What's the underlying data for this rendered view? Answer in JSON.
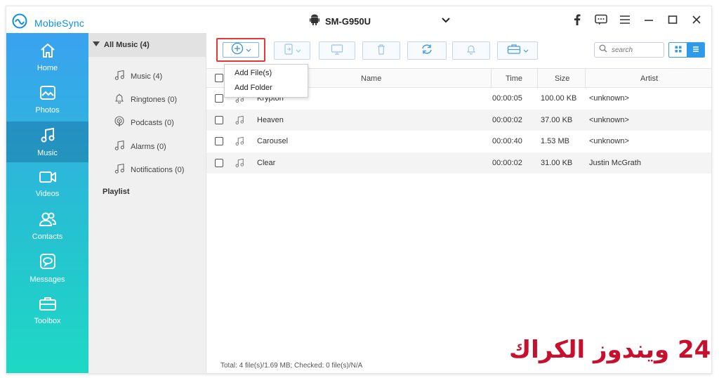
{
  "app": {
    "name": "MobieSync",
    "brand_color": "#0d8fe0"
  },
  "device": {
    "name": "SM-G950U"
  },
  "window_controls": [
    "facebook-icon",
    "feedback-icon",
    "menu-icon",
    "minimize-icon",
    "maximize-icon",
    "close-icon"
  ],
  "sidebar": {
    "items": [
      {
        "label": "Home",
        "icon": "home-icon",
        "active": false
      },
      {
        "label": "Photos",
        "icon": "photos-icon",
        "active": false
      },
      {
        "label": "Music",
        "icon": "music-icon",
        "active": true
      },
      {
        "label": "Videos",
        "icon": "videos-icon",
        "active": false
      },
      {
        "label": "Contacts",
        "icon": "contacts-icon",
        "active": false
      },
      {
        "label": "Messages",
        "icon": "messages-icon",
        "active": false
      },
      {
        "label": "Toolbox",
        "icon": "toolbox-icon",
        "active": false
      }
    ]
  },
  "categories": {
    "header": "All Music (4)",
    "items": [
      {
        "label": "Music (4)",
        "icon": "music-note-icon"
      },
      {
        "label": "Ringtones (0)",
        "icon": "bell-icon"
      },
      {
        "label": "Podcasts (0)",
        "icon": "podcast-icon"
      },
      {
        "label": "Alarms (0)",
        "icon": "music-note-icon"
      },
      {
        "label": "Notifications (0)",
        "icon": "music-note-icon"
      }
    ],
    "playlist": "Playlist"
  },
  "toolbar": {
    "search_placeholder": "search",
    "add_menu": [
      "Add File(s)",
      "Add Folder"
    ]
  },
  "table": {
    "columns": [
      "Name",
      "Time",
      "Size",
      "Artist"
    ],
    "rows": [
      {
        "name": "Krypton",
        "time": "00:00:05",
        "size": "100.00 KB",
        "artist": "<unknown>"
      },
      {
        "name": "Heaven",
        "time": "00:00:02",
        "size": "37.00 KB",
        "artist": "<unknown>"
      },
      {
        "name": "Carousel",
        "time": "00:00:40",
        "size": "1.53 MB",
        "artist": "<unknown>"
      },
      {
        "name": "Clear",
        "time": "00:00:02",
        "size": "31.00 KB",
        "artist": "Justin McGrath"
      }
    ]
  },
  "status": "Total: 4 file(s)/1.69 MB; Checked: 0 file(s)/N/A",
  "watermark": "24 ويندوز الكراك",
  "colors": {
    "accent": "#2e9be8",
    "highlight_border": "#e53935",
    "watermark": "#c8102e"
  }
}
